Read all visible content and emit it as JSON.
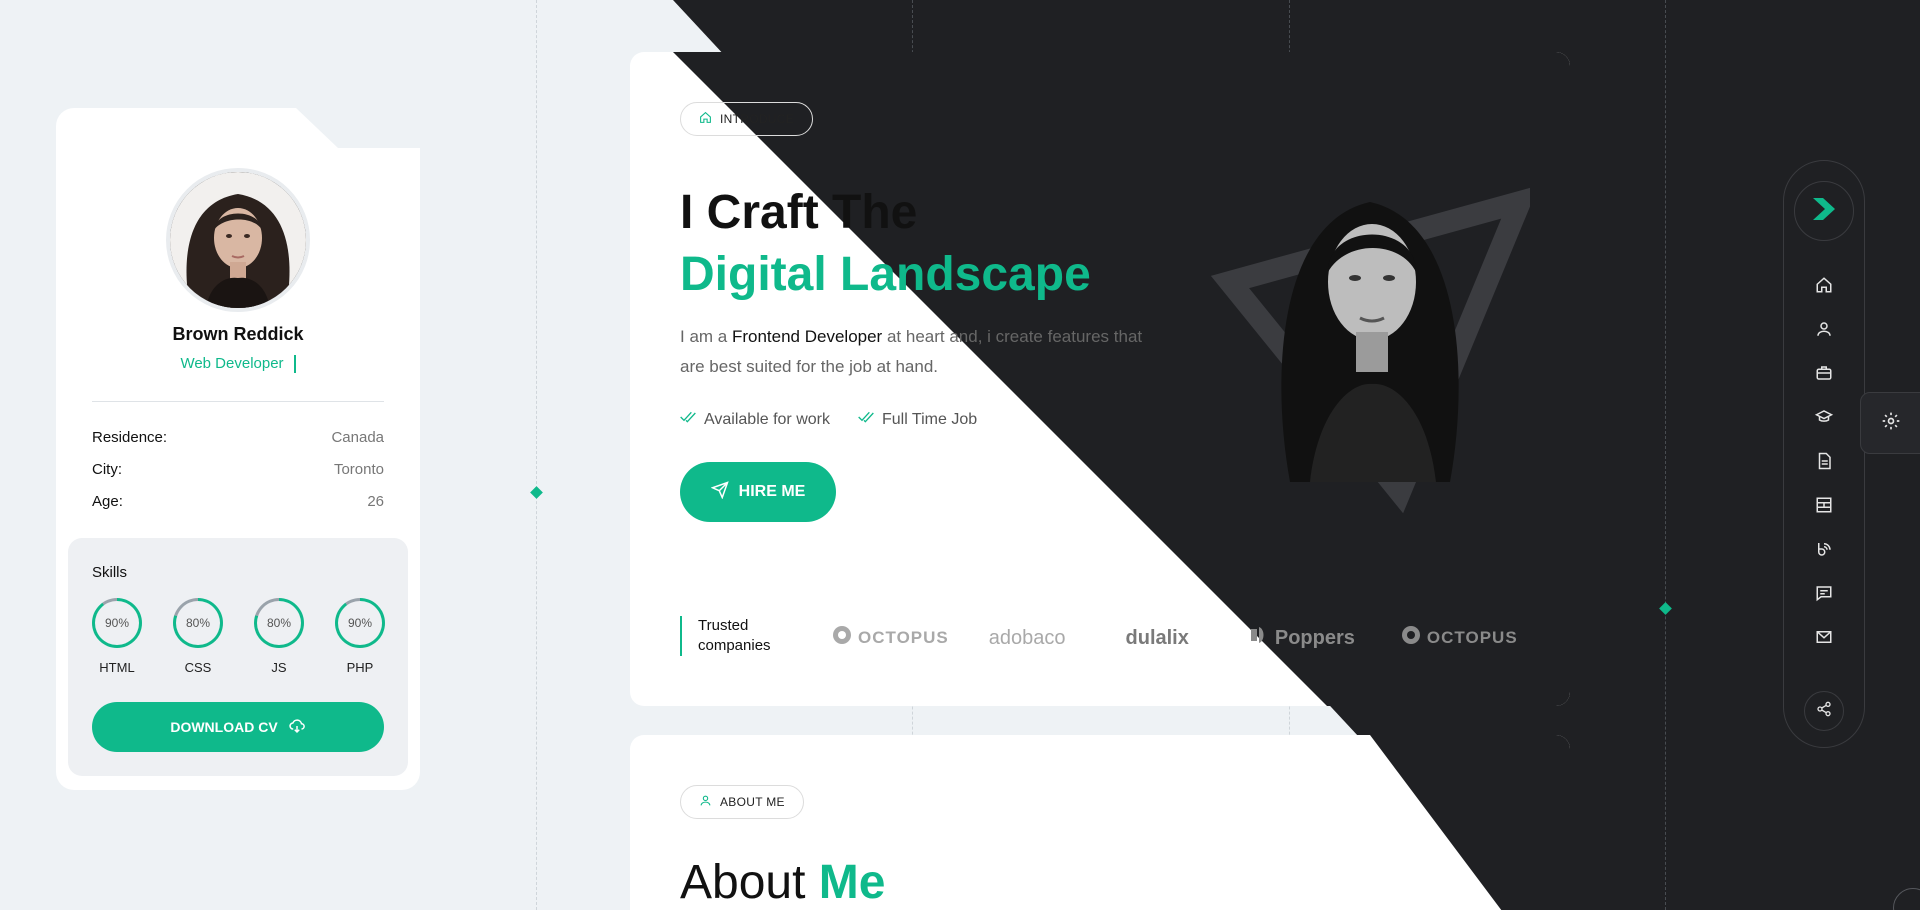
{
  "profile": {
    "name": "Brown Reddick",
    "role": "Web Developer",
    "info": [
      {
        "key": "Residence:",
        "value": "Canada"
      },
      {
        "key": "City:",
        "value": "Toronto"
      },
      {
        "key": "Age:",
        "value": "26"
      }
    ],
    "skills_title": "Skills",
    "skills": [
      {
        "name": "HTML",
        "percent_label": "90%",
        "level": 90
      },
      {
        "name": "CSS",
        "percent_label": "80%",
        "level": 80
      },
      {
        "name": "JS",
        "percent_label": "80%",
        "level": 80
      },
      {
        "name": "PHP",
        "percent_label": "90%",
        "level": 90
      }
    ],
    "download_label": "DOWNLOAD CV"
  },
  "hero": {
    "badge": "INTRODUCE",
    "title_line1": "I Craft The",
    "title_line2": "Digital Landscape",
    "desc_prefix": "I am a ",
    "desc_highlight": "Frontend Developer",
    "desc_suffix": " at heart and, i create features that are best suited for the job at hand.",
    "checks": [
      "Available for work",
      "Full Time Job"
    ],
    "hire_label": "HIRE ME",
    "trusted_line1": "Trusted",
    "trusted_line2": "companies",
    "logos": [
      "OCTOPUS",
      "adobaco",
      "dulalix",
      "Poppers",
      "OCTOPUS"
    ]
  },
  "about": {
    "badge": "ABOUT ME",
    "title_plain": "About",
    "title_accent": "Me"
  },
  "nav": {
    "items": [
      "home-icon",
      "user-icon",
      "briefcase-icon",
      "graduation-cap-icon",
      "document-icon",
      "portfolio-grid-icon",
      "blog-icon",
      "chat-icon",
      "mail-icon"
    ]
  },
  "colors": {
    "accent": "#0fb98b",
    "dark": "#1f2023",
    "light_bg": "#eef2f5"
  }
}
